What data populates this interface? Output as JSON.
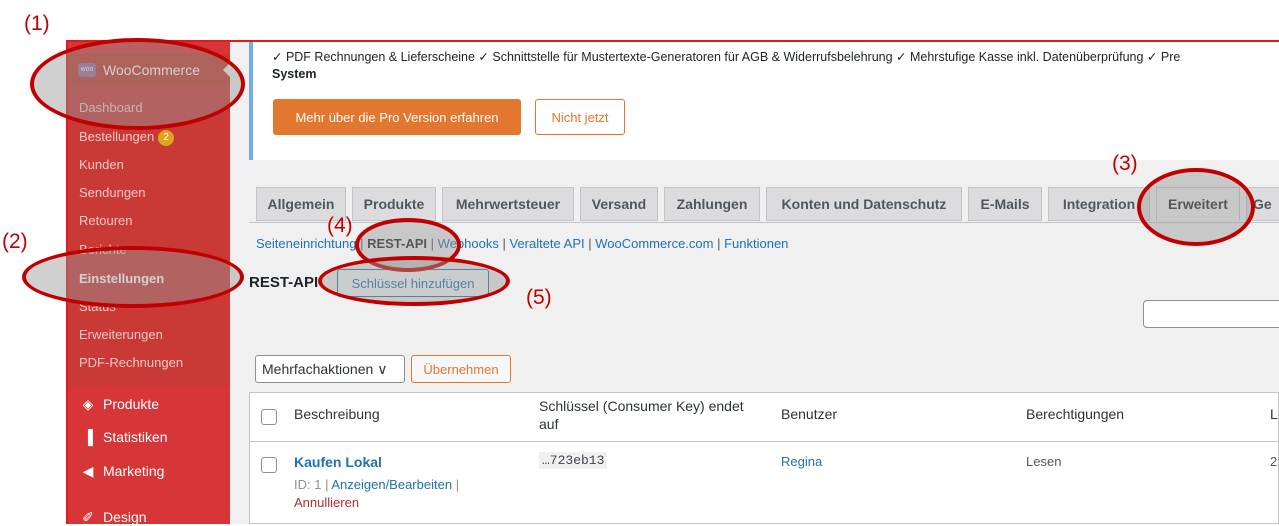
{
  "sidebar": {
    "woocommerce_label": "WooCommerce",
    "woo_logo_text": "woo",
    "submenu": [
      {
        "label": "Dashboard"
      },
      {
        "label": "Bestellungen",
        "badge": "2"
      },
      {
        "label": "Kunden"
      },
      {
        "label": "Sendungen"
      },
      {
        "label": "Retouren"
      },
      {
        "label": "Berichte"
      },
      {
        "label": "Einstellungen"
      },
      {
        "label": "Status"
      },
      {
        "label": "Erweiterungen"
      },
      {
        "label": "PDF-Rechnungen"
      }
    ],
    "menu": [
      {
        "label": "Produkte",
        "icon": "box-icon"
      },
      {
        "label": "Statistiken",
        "icon": "bar-chart-icon"
      },
      {
        "label": "Marketing",
        "icon": "megaphone-icon"
      },
      {
        "label": "Design",
        "icon": "brush-icon"
      }
    ]
  },
  "notice": {
    "line1": "✓ PDF Rechnungen & Lieferscheine ✓ Schnittstelle für Mustertexte-Generatoren für AGB & Widerrufsbelehrung ✓ Mehrstufige Kasse inkl. Datenüberprüfung ✓ Pre",
    "line2": "System",
    "primary_button": "Mehr über die Pro Version erfahren",
    "secondary_button": "Nicht jetzt"
  },
  "tabs": [
    "Allgemein",
    "Produkte",
    "Mehrwertsteuer",
    "Versand",
    "Zahlungen",
    "Konten und Datenschutz",
    "E-Mails",
    "Integration",
    "Erweitert",
    "Ge"
  ],
  "active_tab": "Erweitert",
  "subnav": {
    "items": [
      "Seiteneinrichtung",
      "REST-API",
      "Webhooks",
      "Veraltete API",
      "WooCommerce.com",
      "Funktionen"
    ],
    "separator": " | "
  },
  "page": {
    "title": "REST-API",
    "add_key_button": "Schlüssel hinzufügen",
    "search_value": ""
  },
  "bulk": {
    "selected": "Mehrfachaktionen",
    "apply_button": "Übernehmen"
  },
  "table": {
    "columns": [
      "Beschreibung",
      "Schlüssel (Consumer Key) endet auf",
      "Benutzer",
      "Berechtigungen",
      "L"
    ],
    "rows": [
      {
        "description": "Kaufen Lokal",
        "meta_id": "ID: 1 |",
        "edit_link": "Anzeigen/Bearbeiten",
        "meta_sep": "|",
        "revoke_link": "Annullieren",
        "key_end": "…723eb13",
        "user": "Regina",
        "permissions": "Lesen",
        "last_access": "2:"
      }
    ]
  },
  "annotations": [
    "(1)",
    "(2)",
    "(3)",
    "(4)",
    "(5)"
  ],
  "colors": {
    "sidebar": "#d63638",
    "primary_button": "#e27730",
    "link": "#2271b1",
    "annotation": "#c00000"
  }
}
